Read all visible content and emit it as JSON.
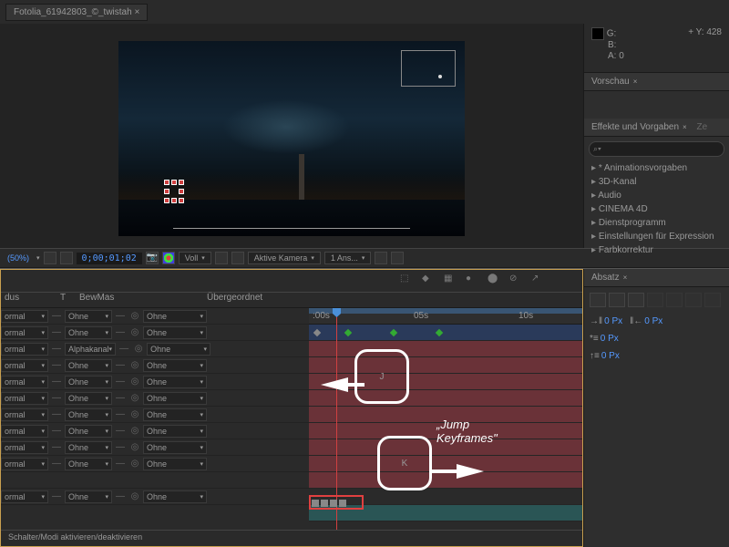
{
  "tab": {
    "title": "Fotolia_61942803_©_twistah"
  },
  "info": {
    "g": "G:",
    "b": "B:",
    "a": "A:",
    "a_val": "0",
    "y": "Y:",
    "y_val": "428"
  },
  "panels": {
    "vorschau": "Vorschau",
    "effekte": "Effekte und Vorgaben",
    "ze": "Ze",
    "absatz": "Absatz"
  },
  "search_placeholder": "⌕▾",
  "effects_tree": [
    "* Animationsvorgaben",
    "3D-Kanal",
    "Audio",
    "CINEMA 4D",
    "Dienstprogramm",
    "Einstellungen für Expression",
    "Farbkorrektur"
  ],
  "toolbar": {
    "zoom": "(50%)",
    "timecode": "0;00;01;02",
    "resolution": "Voll",
    "camera": "Aktive Kamera",
    "views": "1 Ans..."
  },
  "timeline": {
    "col_dus": "dus",
    "col_t": "T",
    "col_bewmas": "BewMas",
    "col_parent": "Übergeordnet",
    "time_00": ":00s",
    "time_05": "05s",
    "time_10": "10s",
    "mode_normal": "ormal",
    "bm_ohne": "Ohne",
    "bm_alpha": "Alphakanal",
    "parent_ohne": "Ohne",
    "footer": "Schalter/Modi aktivieren/deaktivieren"
  },
  "overlay": {
    "j": "J",
    "k": "K",
    "label": "„Jump Keyframes\""
  },
  "indent": {
    "v1": "0 Px",
    "v2": "0 Px",
    "v3": "0 Px",
    "v4": "0 Px"
  }
}
